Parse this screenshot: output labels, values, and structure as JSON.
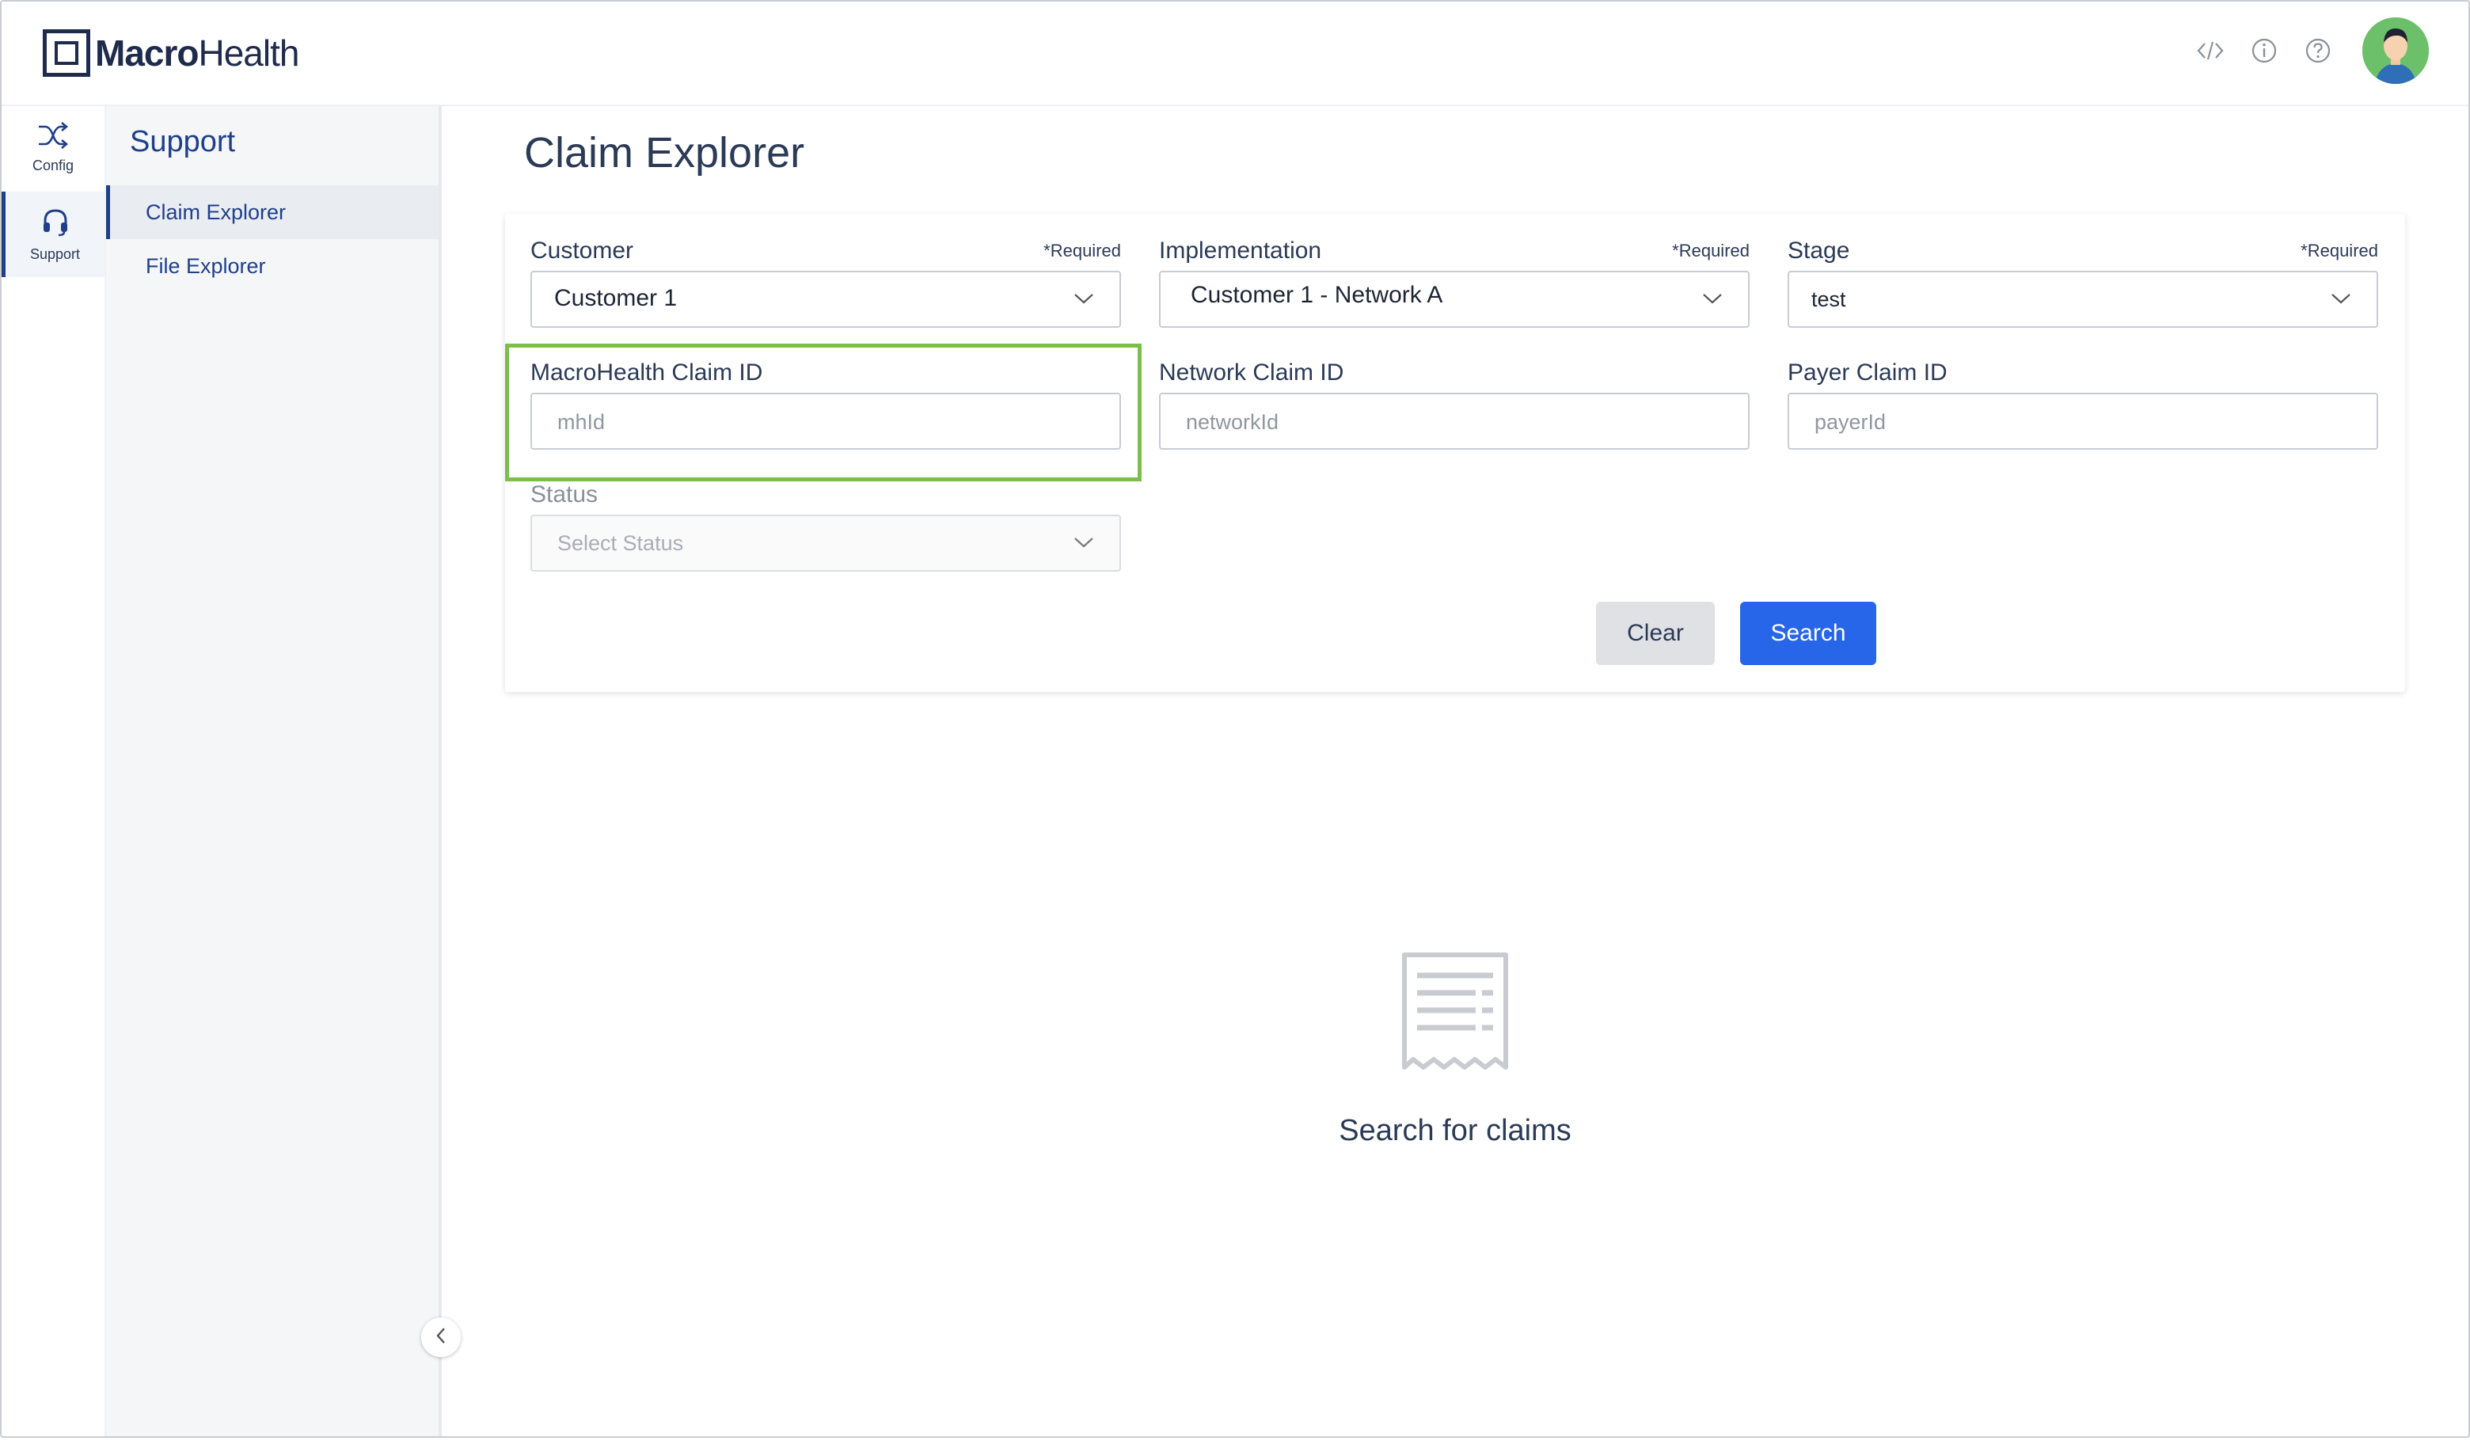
{
  "brand": {
    "name_bold": "Macro",
    "name_rest": "Health"
  },
  "header": {
    "icons": [
      "code-icon",
      "info-icon",
      "help-icon"
    ],
    "avatar": "user-avatar"
  },
  "rail": {
    "items": [
      {
        "label": "Config",
        "icon": "shuffle-icon"
      },
      {
        "label": "Support",
        "icon": "headset-icon"
      }
    ]
  },
  "subnav": {
    "title": "Support",
    "items": [
      {
        "label": "Claim Explorer"
      },
      {
        "label": "File Explorer"
      }
    ]
  },
  "page": {
    "title": "Claim Explorer"
  },
  "form": {
    "customer": {
      "label": "Customer",
      "required": "*Required",
      "value": "Customer 1"
    },
    "implementation": {
      "label": "Implementation",
      "required": "*Required",
      "value": "Customer 1 - Network A"
    },
    "stage": {
      "label": "Stage",
      "required": "*Required",
      "value": "test"
    },
    "mh_claim": {
      "label": "MacroHealth Claim ID",
      "placeholder": "mhId"
    },
    "network_claim": {
      "label": "Network Claim ID",
      "placeholder": "networkId"
    },
    "payer_claim": {
      "label": "Payer Claim ID",
      "placeholder": "payerId"
    },
    "status": {
      "label": "Status",
      "placeholder": "Select Status"
    },
    "clear_label": "Clear",
    "search_label": "Search"
  },
  "empty_state": {
    "text": "Search for claims",
    "icon": "receipt-icon"
  },
  "colors": {
    "accent": "#2766e8",
    "nav": "#1f3f8a",
    "highlight": "#7bbf4a",
    "avatar_bg": "#6cc06a"
  }
}
